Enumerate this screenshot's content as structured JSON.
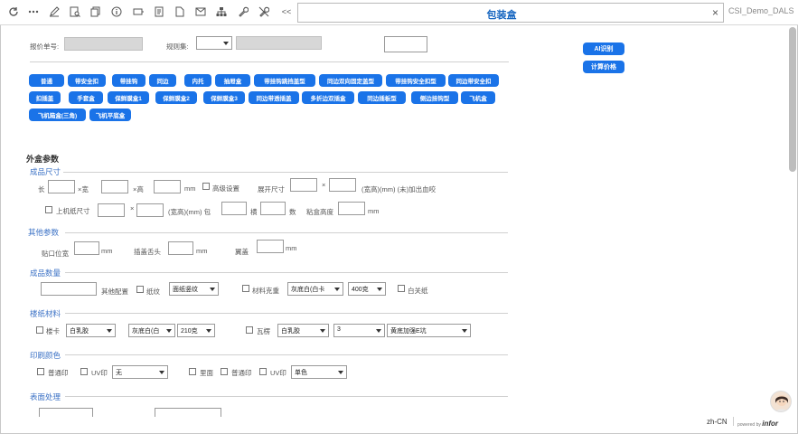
{
  "toolbar": {
    "icons": [
      "refresh-icon",
      "more-icon",
      "edit-icon",
      "find-record-icon",
      "copy-icon",
      "info-icon",
      "tag-icon",
      "note-icon",
      "document-icon",
      "mail-icon",
      "hierarchy-icon",
      "wrench-icon",
      "tools-off-icon"
    ],
    "collapse_label": "<<",
    "search_value": "包装盒",
    "clear_label": "×",
    "tab_title": "CSI_Demo_DALS"
  },
  "header": {
    "quote_no_label": "报价单号:",
    "rule_set_label": "规则集:",
    "rule_set_value": ""
  },
  "actions": {
    "ai_label": "AI识别",
    "calc_label": "计算价格"
  },
  "box_types": [
    "普通",
    "带安全扣",
    "带挂钩",
    "同边",
    "内托",
    "抽屉盒",
    "带挂钩跳挡盖型",
    "同边双向固定盖型",
    "带挂钩安全扣型",
    "同边带安全扣",
    "扣插盖",
    "手套盒",
    "保鲜膜盒1",
    "保鲜膜盒2",
    "保鲜膜盒3",
    "同边带透插盖",
    "多折边双插盒",
    "同边插板型",
    "侧边挂钩型",
    "飞机盒",
    "飞机箱盒(三角)",
    "飞机平底盒"
  ],
  "outer": {
    "section_title": "外盒参数",
    "size": {
      "title": "成品尺寸",
      "length_label": "长",
      "width_label": "×宽",
      "height_label": "×高",
      "mm": "mm",
      "advanced_label": "高级设置",
      "unfold_label": "展开尺寸",
      "times": "×",
      "unfold_unit": "(宽高)(mm) (未)加出血咬",
      "machine_label": "上机纸尺寸",
      "machine_unit": "(宽高)(mm) 包",
      "horizontal_label": "横",
      "count_label": "数",
      "glue_height_label": "粘盒高度",
      "mm2": "mm"
    },
    "other": {
      "title": "其他参数",
      "glue_pos_label": "贴口位宽",
      "mm_a": "mm",
      "tongue_label": "插盖舌头",
      "mm_b": "mm",
      "wing_label": "翼盖",
      "mm_c": "mm"
    },
    "qty": {
      "title": "成品数量",
      "other_config_label": "其他配置",
      "paper_grain_label": "纸纹",
      "paper_grain_value": "面纸竖纹",
      "material_reserve_label": "材料克重",
      "material_value": "灰底白(白卡",
      "gram_value": "400克",
      "white_paper_label": "白关纸"
    },
    "material": {
      "title": "楼纸材料",
      "card_label": "楼卡",
      "card_value": "白乳胶",
      "paper_value": "灰底白(白",
      "gram_value": "210克",
      "corrugate_label": "瓦楞",
      "corrugate_value": "白乳胶",
      "layer_value": "3",
      "flute_value": "黄底加强E坑"
    },
    "print": {
      "title": "印刷颜色",
      "normal_label": "普通印",
      "uv_label": "UV印",
      "uv_value": "无",
      "back_label": "里面",
      "normal2_label": "普通印",
      "uv2_label": "UV印",
      "color_value": "单色"
    },
    "surface": {
      "title": "表面处理"
    }
  },
  "footer": {
    "lang": "zh-CN",
    "powered": "powered by",
    "brand": "infor"
  }
}
